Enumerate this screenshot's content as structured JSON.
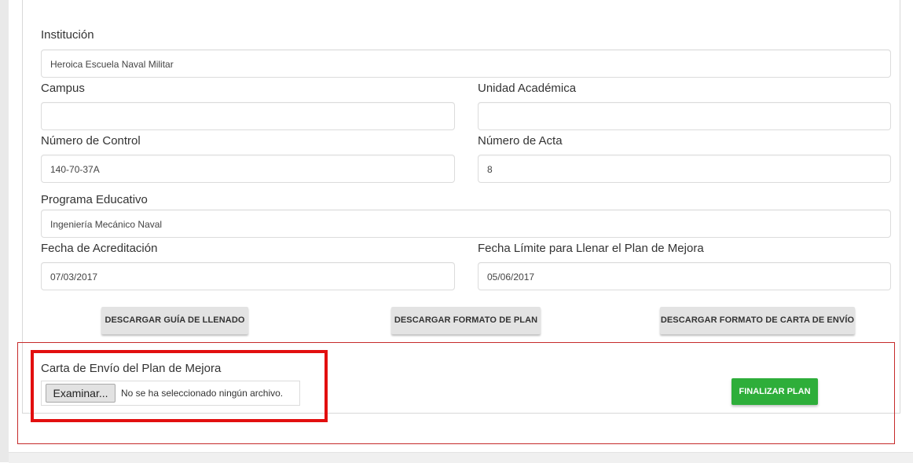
{
  "form": {
    "institucion": {
      "label": "Institución",
      "value": "Heroica Escuela Naval Militar"
    },
    "campus": {
      "label": "Campus",
      "value": ""
    },
    "unidad": {
      "label": "Unidad Académica",
      "value": ""
    },
    "numero_control": {
      "label": "Número de Control",
      "value": "140-70-37A"
    },
    "numero_acta": {
      "label": "Número de Acta",
      "value": "8"
    },
    "programa": {
      "label": "Programa Educativo",
      "value": "Ingeniería Mecánico Naval"
    },
    "fecha_acreditacion": {
      "label": "Fecha de Acreditación",
      "value": "07/03/2017"
    },
    "fecha_limite": {
      "label": "Fecha Límite para Llenar el Plan de Mejora",
      "value": "05/06/2017"
    }
  },
  "buttons": {
    "guia": "DESCARGAR GUÍA DE LLENADO",
    "formato_plan": "DESCARGAR FORMATO DE PLAN",
    "formato_carta": "DESCARGAR FORMATO DE CARTA DE ENVÍO",
    "finalizar": "FINALIZAR PLAN"
  },
  "upload": {
    "label": "Carta de Envío del Plan de Mejora",
    "browse_button": "Examinar...",
    "status": "No se ha seleccionado ningún archivo."
  },
  "colors": {
    "finalizar_bg": "#2eae3a",
    "highlight_red": "#e20f0f"
  }
}
